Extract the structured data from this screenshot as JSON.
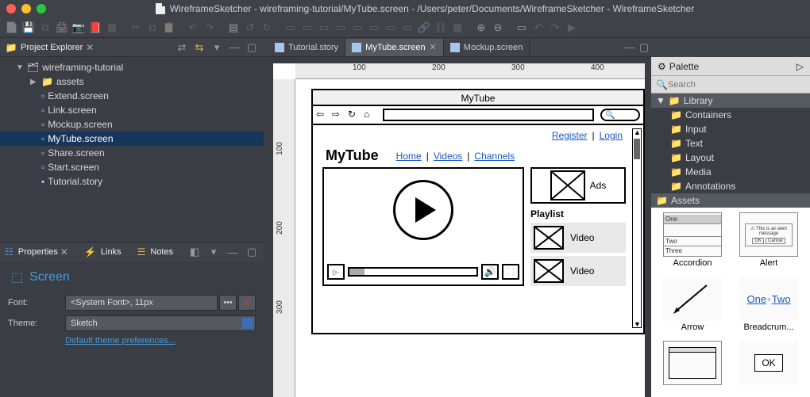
{
  "window": {
    "title": "WireframeSketcher - wireframing-tutorial/MyTube.screen - /Users/peter/Documents/WireframeSketcher - WireframeSketcher"
  },
  "views": {
    "project_explorer": {
      "title": "Project Explorer",
      "root": "wireframing-tutorial",
      "assets_folder": "assets",
      "files": {
        "extend": "Extend.screen",
        "link": "Link.screen",
        "mockup": "Mockup.screen",
        "mytube": "MyTube.screen",
        "share": "Share.screen",
        "start": "Start.screen",
        "tutorial": "Tutorial.story"
      }
    },
    "properties": {
      "title": "Properties",
      "links_tab": "Links",
      "notes_tab": "Notes",
      "section": "Screen",
      "font_label": "Font:",
      "font_value": "<System Font>, 11px",
      "theme_label": "Theme:",
      "theme_value": "Sketch",
      "theme_link": "Default theme preferences..."
    },
    "palette": {
      "title": "Palette",
      "search_placeholder": "Search",
      "library": "Library",
      "groups": {
        "containers": "Containers",
        "input": "Input",
        "text": "Text",
        "layout": "Layout",
        "media": "Media",
        "annotations": "Annotations"
      },
      "assets": "Assets",
      "items": {
        "accordion": {
          "label": "Accordion",
          "l1": "One",
          "l2": "Two",
          "l3": "Three"
        },
        "alert": {
          "label": "Alert",
          "msg": "This is an alert message",
          "ok": "OK",
          "cancel": "Cancel"
        },
        "arrow": {
          "label": "Arrow"
        },
        "breadcrumb": {
          "label": "Breadcrum...",
          "one": "One",
          "two": "Two"
        },
        "button": {
          "label": "OK"
        }
      }
    }
  },
  "editor": {
    "tabs": {
      "tutorial": "Tutorial.story",
      "mytube": "MyTube.screen",
      "mockup": "Mockup.screen"
    },
    "ruler": {
      "t100": "100",
      "t200": "200",
      "t300": "300",
      "t400": "400",
      "v100": "100",
      "v200": "200",
      "v300": "300"
    }
  },
  "mockup": {
    "window_title": "MyTube",
    "logo": "MyTube",
    "nav": {
      "home": "Home",
      "videos": "Videos",
      "channels": "Channels"
    },
    "top_links": {
      "register": "Register",
      "login": "Login"
    },
    "ads": "Ads",
    "playlist_title": "Playlist",
    "video_row": "Video"
  }
}
